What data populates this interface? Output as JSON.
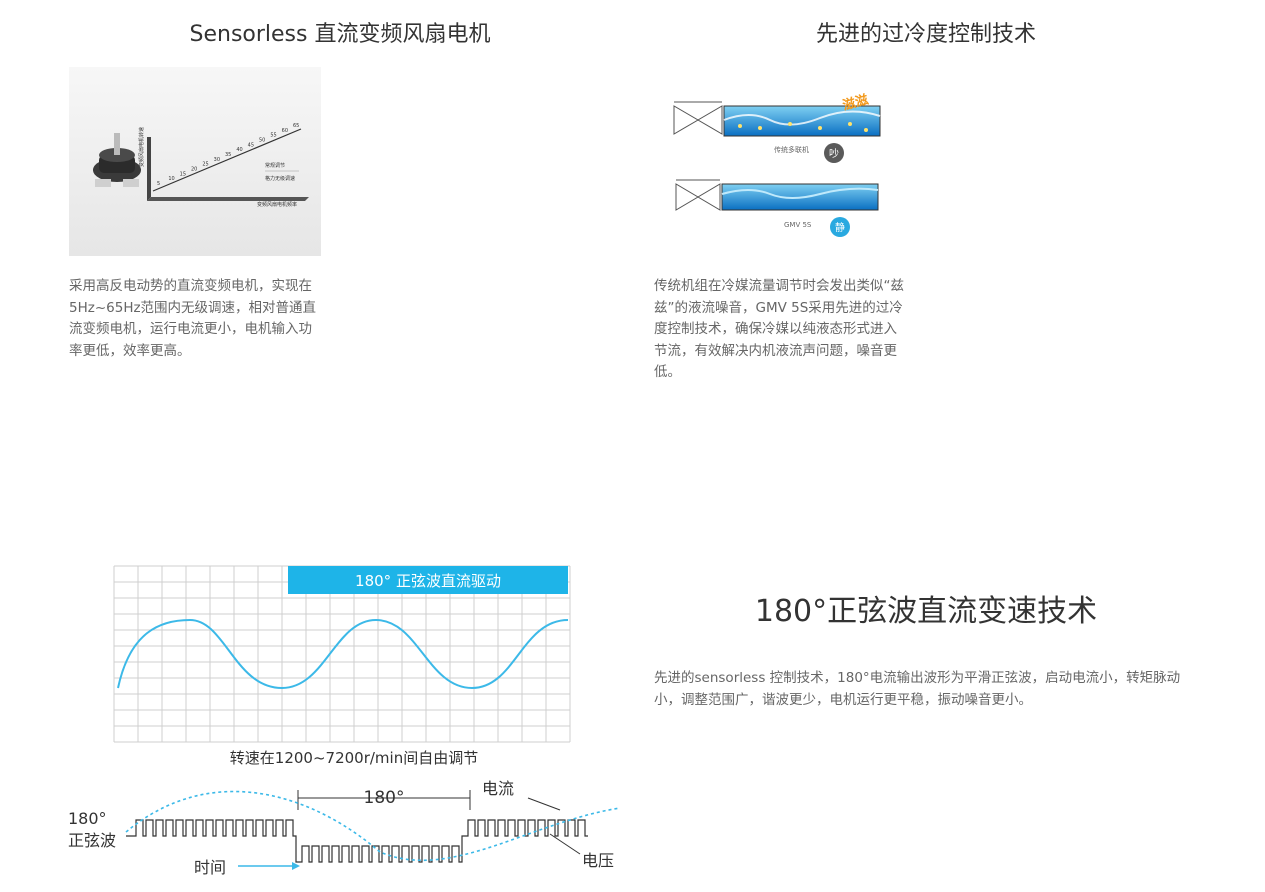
{
  "feature1": {
    "title": "Sensorless 直流变频风扇电机",
    "desc": "采用高反电动势的直流变频电机，实现在5Hz~65Hz范围内无级调速，相对普通直流变频电机，运行电流更小，电机输入功率更低，效率更高。",
    "image": {
      "ylabel": "变频风扇电机转速",
      "xlabel": "变频风扇电机频率",
      "tick_values": [
        "5",
        "10",
        "15",
        "20",
        "25",
        "30",
        "35",
        "40",
        "45",
        "50",
        "55",
        "60",
        "65"
      ],
      "legend": [
        "常规调节",
        "格力无级调速"
      ]
    }
  },
  "feature2": {
    "title": "先进的过冷度控制技术",
    "desc": "传统机组在冷媒流量调节时会发出类似“兹兹”的液流噪音，GMV 5S采用先进的过冷度控制技术，确保冷媒以纯液态形式进入节流，有效解决内机液流声问题，噪音更低。",
    "image": {
      "noise_text": "滋滋",
      "top_label": "传统多联机",
      "top_badge": "吵",
      "bottom_label": "GMV 5S",
      "bottom_badge": "静",
      "top_badge_color": "#5a5a5a",
      "bottom_badge_color": "#29a9e0"
    }
  },
  "feature3": {
    "title": "180°正弦波直流变速技术",
    "desc": "先进的sensorless 控制技术，180°电流输出波形为平滑正弦波，启动电流小，转矩脉动小，调整范围广，谐波更少，电机运行更平稳，振动噪音更小。",
    "image": {
      "banner": "180° 正弦波直流驱动",
      "speed_caption": "转速在1200~7200r/min间自由调节",
      "angle": "180°",
      "current_label": "电流",
      "sine_label_line1": "180°",
      "sine_label_line2": "正弦波",
      "time_label": "时间",
      "voltage_label": "电压",
      "accent_color": "#1eb4e8"
    }
  }
}
